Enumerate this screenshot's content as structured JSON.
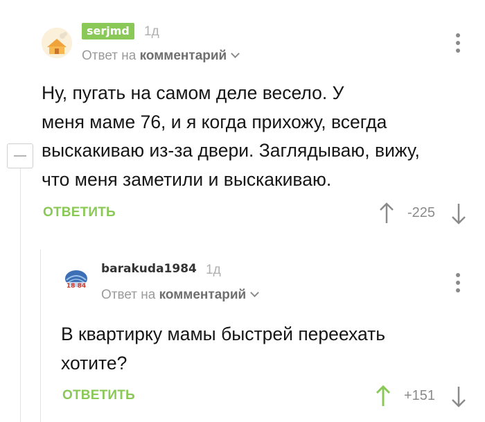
{
  "comment": {
    "username": "serjmd",
    "time": "1д",
    "reply_to_prefix": "Ответ на",
    "reply_to_target": "комментарий",
    "body_lines": [
      "Ну, пугать на самом деле весело. У",
      "меня маме 76, и я когда прихожу, всегда",
      "выскакиваю из-за двери. Заглядываю, вижу,",
      "что меня заметили и выскакиваю."
    ],
    "reply_label": "ОТВЕТИТЬ",
    "rating": "-225",
    "upvote_icon": "arrow-up-icon",
    "downvote_icon": "arrow-down-icon"
  },
  "reply": {
    "username": "barakuda1984",
    "time": "1д",
    "reply_to_prefix": "Ответ на",
    "reply_to_target": "комментарий",
    "body_lines": [
      "В квартирку мамы быстрей переехать",
      "хотите?"
    ],
    "reply_label": "ОТВЕТИТЬ",
    "rating": "+151",
    "upvote_active": true,
    "avatar_text": "18 84"
  },
  "colors": {
    "accent_green": "#8ac858",
    "muted_gray": "#8a8a8a",
    "text": "#161616"
  }
}
